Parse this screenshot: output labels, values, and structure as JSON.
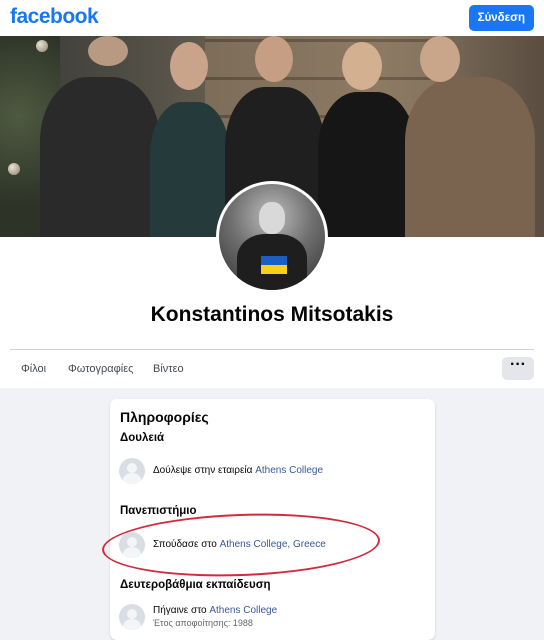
{
  "header": {
    "logo": "facebook",
    "login_label": "Σύνδεση"
  },
  "profile": {
    "name": "Konstantinos Mitsotakis"
  },
  "tabs": [
    {
      "label": "Φίλοι"
    },
    {
      "label": "Φωτογραφίες"
    },
    {
      "label": "Βίντεο"
    }
  ],
  "more_label": "···",
  "about": {
    "title": "Πληροφορίες",
    "work": {
      "heading": "Δουλειά",
      "prefix": "Δούλεψε στην εταιρεία",
      "link": "Athens College"
    },
    "university": {
      "heading": "Πανεπιστήμιο",
      "prefix": "Σπούδασε στο",
      "link": "Athens College, Greece"
    },
    "secondary": {
      "heading": "Δευτεροβάθμια εκπαίδευση",
      "prefix": "Πήγαινε στο",
      "link": "Athens College",
      "sub": "Έτος αποφοίτησης: 1988"
    }
  },
  "colors": {
    "brand": "#1877f2",
    "link": "#385898",
    "annotation": "#d12b3f"
  }
}
